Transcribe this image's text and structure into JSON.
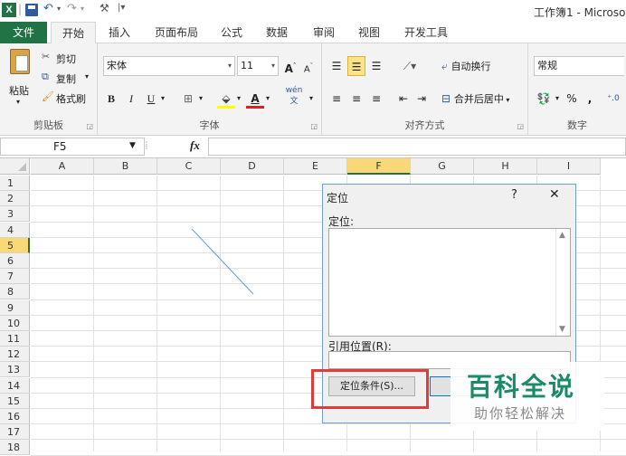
{
  "window": {
    "title": "工作簿1 - Microso"
  },
  "quick_access": {
    "separator": "|"
  },
  "tabs": [
    "文件",
    "开始",
    "插入",
    "页面布局",
    "公式",
    "数据",
    "审阅",
    "视图",
    "开发工具"
  ],
  "ribbon": {
    "clipboard": {
      "label": "剪贴板",
      "paste": "粘贴",
      "cut": "剪切",
      "copy": "复制",
      "format_painter": "格式刷"
    },
    "font": {
      "label": "字体",
      "name": "宋体",
      "size": "11",
      "bold": "B",
      "italic": "I",
      "underline": "U",
      "grow": "A",
      "shrink": "A",
      "font_color_glyph": "A",
      "phonetic": "wén"
    },
    "alignment": {
      "label": "对齐方式",
      "wrap": "自动换行",
      "merge": "合并后居中"
    },
    "number": {
      "label": "数字",
      "format": "常规",
      "percent": "%",
      "comma": ","
    }
  },
  "formula_bar": {
    "name_box": "F5",
    "fx": "fx",
    "value": ""
  },
  "grid": {
    "columns": [
      "A",
      "B",
      "C",
      "D",
      "E",
      "F",
      "G",
      "H",
      "I"
    ],
    "rows": [
      "1",
      "2",
      "3",
      "4",
      "5",
      "6",
      "7",
      "8",
      "9",
      "10",
      "11",
      "12",
      "13",
      "14",
      "15",
      "16",
      "17",
      "18"
    ],
    "active_cell": "F5"
  },
  "dialog": {
    "title": "定位",
    "help": "?",
    "close": "✕",
    "goto_label": "定位:",
    "reference_label": "引用位置(R):",
    "special_button": "定位条件(S)...",
    "reference_value": ""
  },
  "watermark": {
    "title": "百科全说",
    "subtitle": "助你轻松解决"
  },
  "colors": {
    "file_tab": "#217346",
    "highlight": "#e03c3c",
    "selected_header": "#f9d877"
  }
}
